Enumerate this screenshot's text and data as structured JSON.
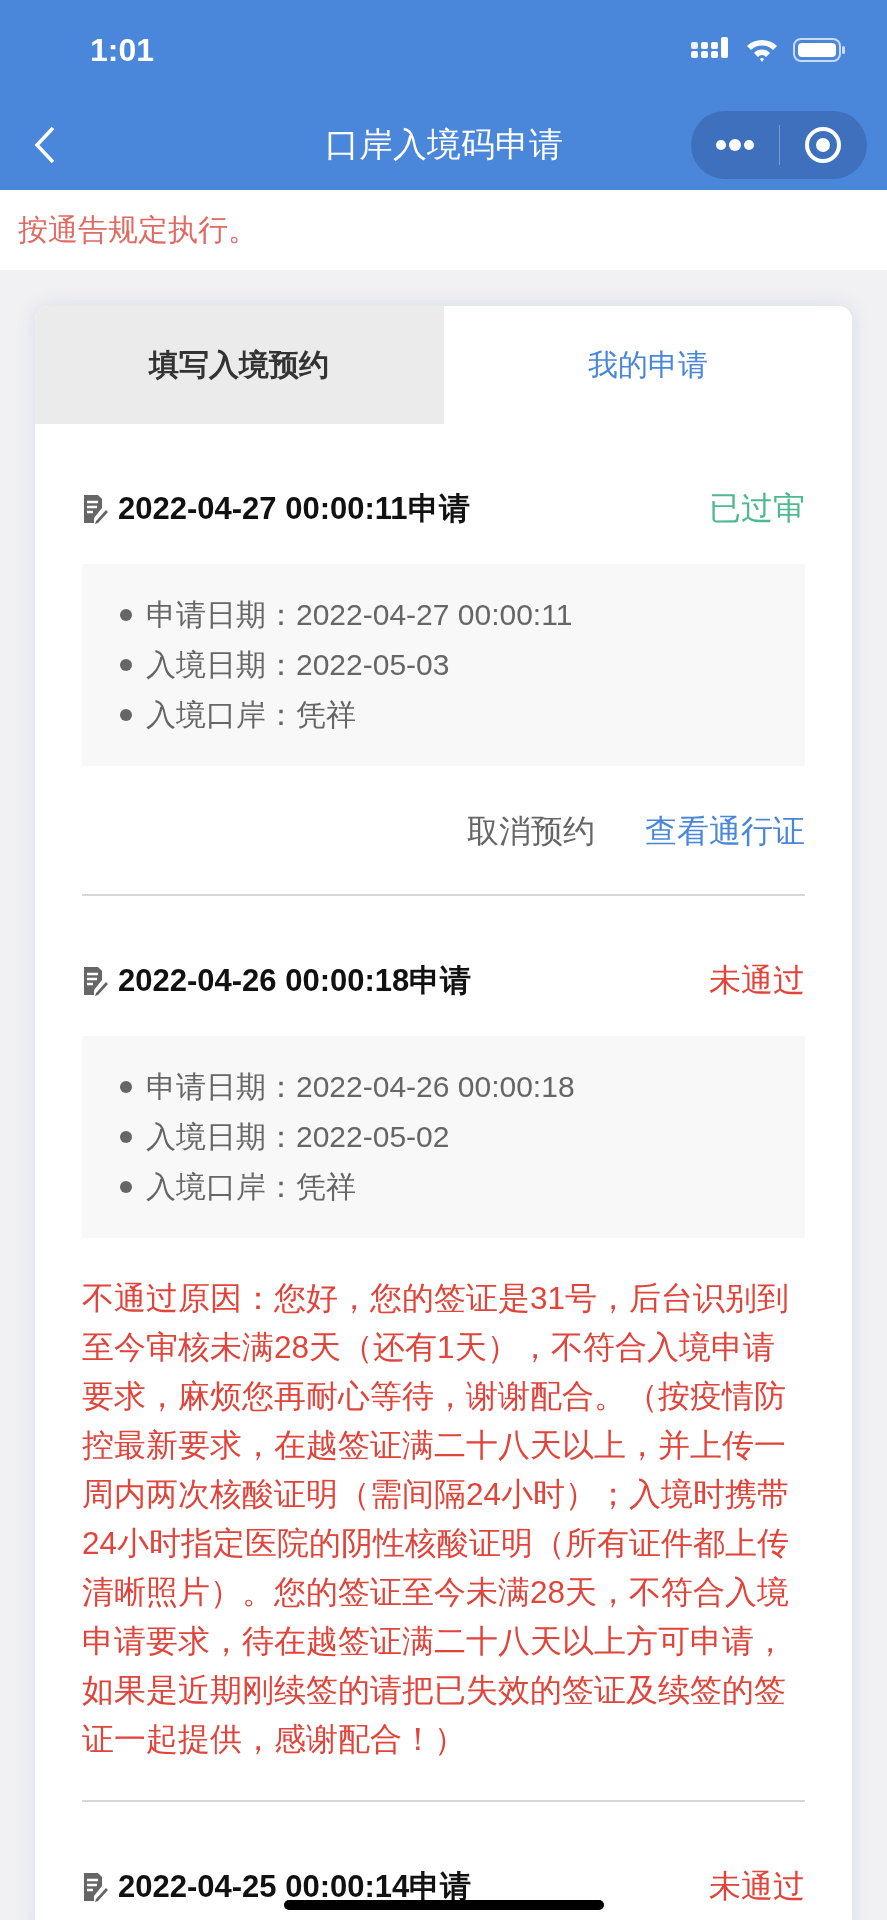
{
  "status_bar": {
    "time": "1:01"
  },
  "nav": {
    "title": "口岸入境码申请"
  },
  "notice": "按通告规定执行。",
  "tabs": [
    {
      "label": "填写入境预约",
      "selected": false
    },
    {
      "label": "我的申请",
      "selected": true
    }
  ],
  "records": [
    {
      "title": "2022-04-27 00:00:11申请",
      "status": {
        "text": "已过审",
        "kind": "approved"
      },
      "details": [
        {
          "label": "申请日期：",
          "value": "2022-04-27 00:00:11"
        },
        {
          "label": "入境日期：",
          "value": "2022-05-03"
        },
        {
          "label": "入境口岸：",
          "value": "凭祥"
        }
      ],
      "actions": [
        {
          "label": "取消预约",
          "kind": "secondary"
        },
        {
          "label": "查看通行证",
          "kind": "primary"
        }
      ]
    },
    {
      "title": "2022-04-26 00:00:18申请",
      "status": {
        "text": "未通过",
        "kind": "rejected"
      },
      "details": [
        {
          "label": "申请日期：",
          "value": "2022-04-26 00:00:18"
        },
        {
          "label": "入境日期：",
          "value": "2022-05-02"
        },
        {
          "label": "入境口岸：",
          "value": "凭祥"
        }
      ],
      "reason": "不通过原因：您好，您的签证是31号，后台识别到至今审核未满28天（还有1天），不符合入境申请要求，麻烦您再耐心等待，谢谢配合。（按疫情防控最新要求，在越签证满二十八天以上，并上传一周内两次核酸证明（需间隔24小时）；入境时携带24小时指定医院的阴性核酸证明（所有证件都上传清晰照片）。您的签证至今未满28天，不符合入境申请要求，待在越签证满二十八天以上方可申请，如果是近期刚续签的请把已失效的签证及续签的签证一起提供，感谢配合！）"
    },
    {
      "title": "2022-04-25 00:00:14申请",
      "status": {
        "text": "未通过",
        "kind": "rejected"
      }
    }
  ]
}
